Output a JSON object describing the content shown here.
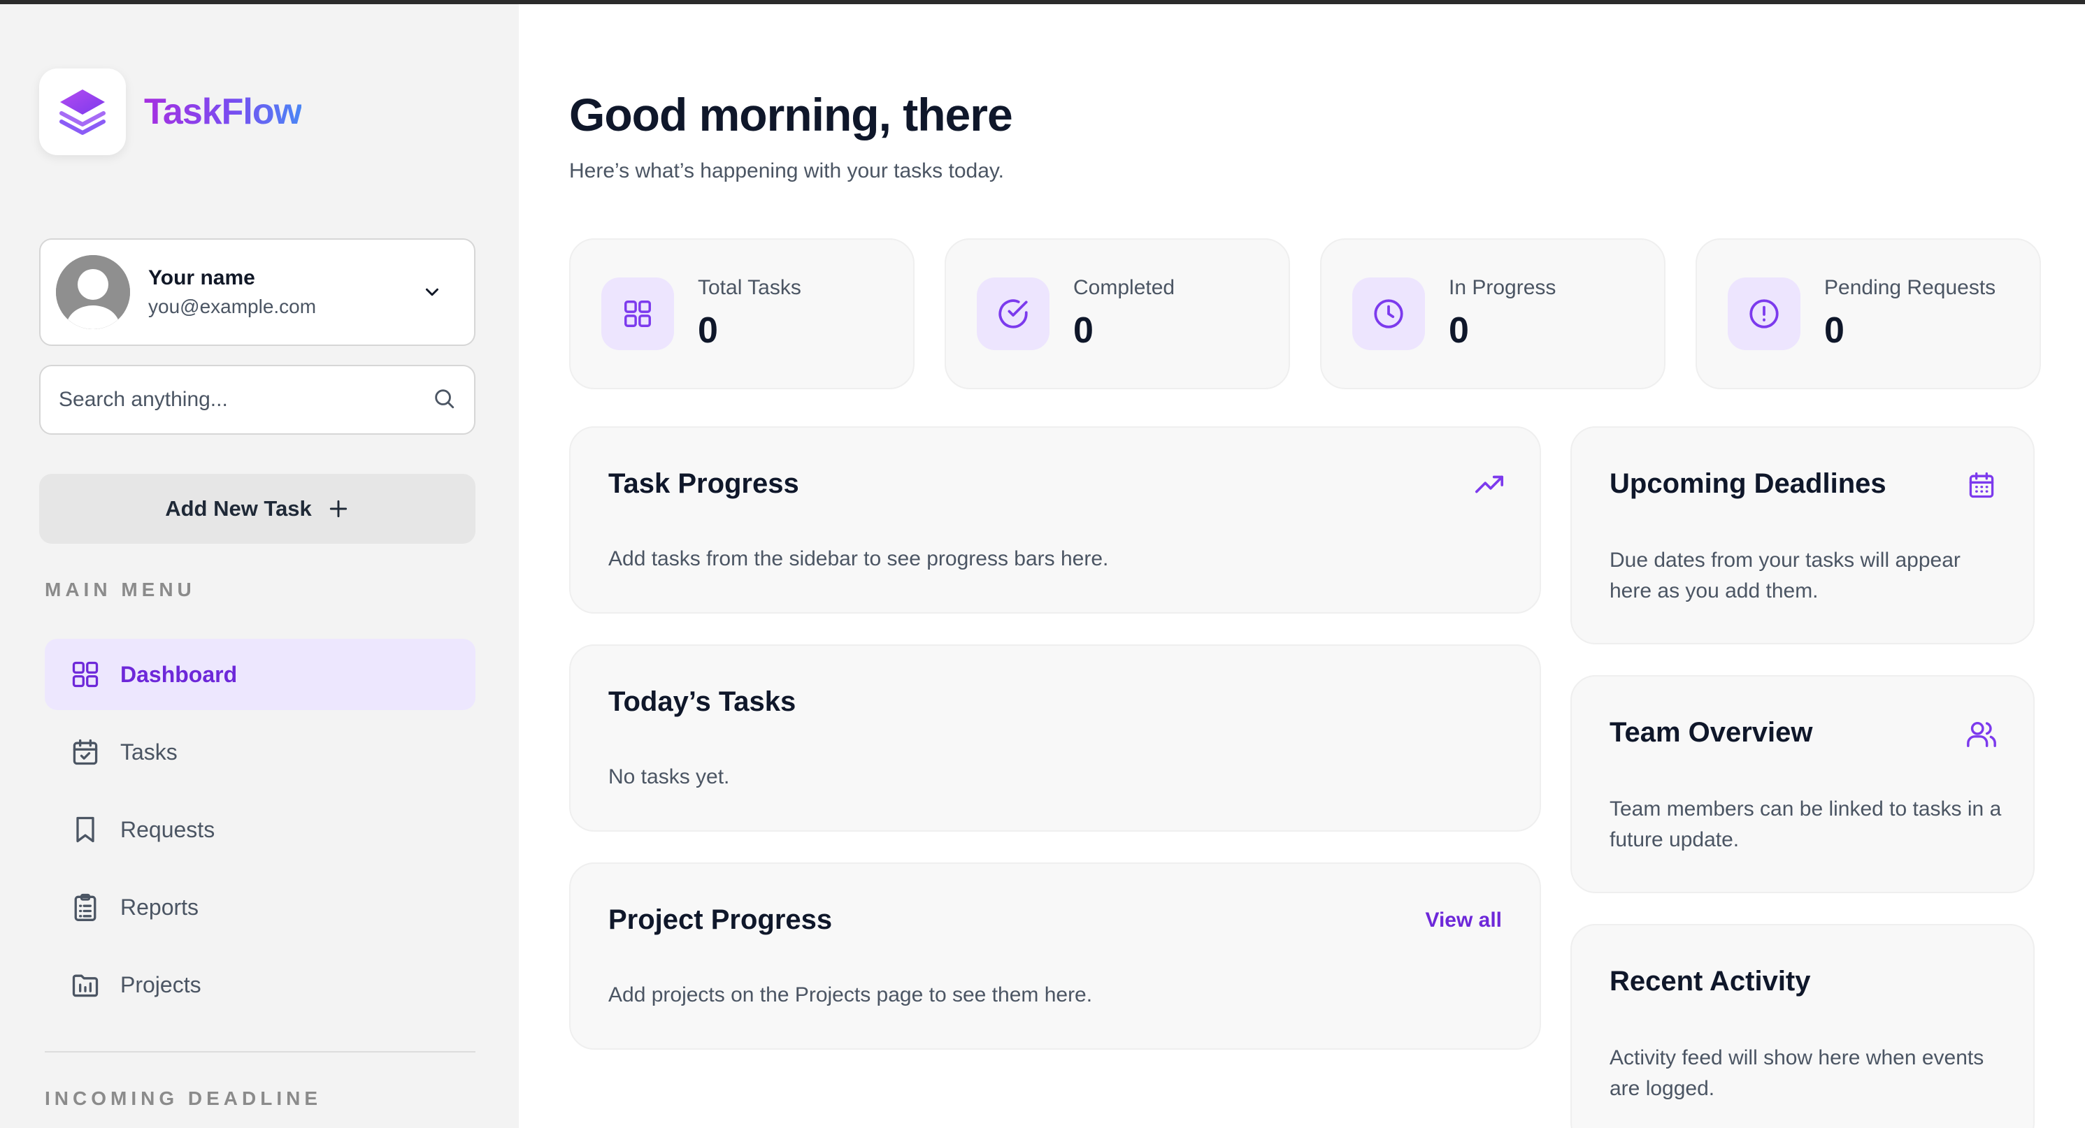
{
  "app": {
    "name": "TaskFlow"
  },
  "user": {
    "name": "Your name",
    "email": "you@example.com"
  },
  "search": {
    "placeholder": "Search anything..."
  },
  "sidebar": {
    "add_task_label": "Add New Task",
    "main_menu_label": "MAIN MENU",
    "items": [
      {
        "label": "Dashboard",
        "icon": "grid-icon",
        "active": true
      },
      {
        "label": "Tasks",
        "icon": "calendar-check-icon"
      },
      {
        "label": "Requests",
        "icon": "bookmark-icon"
      },
      {
        "label": "Reports",
        "icon": "clipboard-list-icon"
      },
      {
        "label": "Projects",
        "icon": "folder-chart-icon"
      }
    ],
    "incoming_deadline_label": "INCOMING DEADLINE"
  },
  "header": {
    "greeting": "Good morning, there",
    "subtitle": "Here’s what’s happening with your tasks today."
  },
  "stats": [
    {
      "label": "Total Tasks",
      "value": "0",
      "icon": "grid-icon"
    },
    {
      "label": "Completed",
      "value": "0",
      "icon": "check-circle-icon"
    },
    {
      "label": "In Progress",
      "value": "0",
      "icon": "clock-icon"
    },
    {
      "label": "Pending Requests",
      "value": "0",
      "icon": "alert-circle-icon"
    }
  ],
  "cards": {
    "task_progress": {
      "title": "Task Progress",
      "body": "Add tasks from the sidebar to see progress bars here.",
      "icon": "trending-up-icon"
    },
    "todays_tasks": {
      "title": "Today’s Tasks",
      "body": "No tasks yet."
    },
    "project_progress": {
      "title": "Project Progress",
      "body": "Add projects on the Projects page to see them here.",
      "link": "View all"
    },
    "upcoming_deadlines": {
      "title": "Upcoming Deadlines",
      "body": "Due dates from your tasks will appear here as you add them.",
      "icon": "calendar-icon"
    },
    "team_overview": {
      "title": "Team Overview",
      "body": "Team members can be linked to tasks in a future update.",
      "icon": "users-icon"
    },
    "recent_activity": {
      "title": "Recent Activity",
      "body": "Activity feed will show here when events are logged."
    }
  },
  "colors": {
    "accent": "#7c3aed",
    "accent_bg": "#ede7fe",
    "sidebar_bg": "#f3f3f3",
    "card_bg": "#f8f8f8"
  }
}
